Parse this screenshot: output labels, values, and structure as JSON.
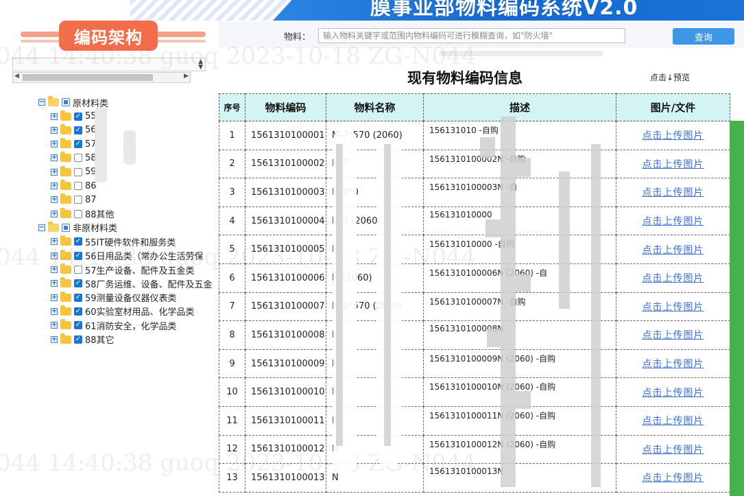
{
  "header": {
    "app_title": "膜事业部物料编码系统V2.0",
    "logo_text": "编码架构"
  },
  "search": {
    "label": "物料：",
    "placeholder": "输入物料关键字或范围内物料编码可进行模糊查询，如\"防火墙\"",
    "button": "查询"
  },
  "table_title": "现有物料编码信息",
  "preview_text": "点击↓预览",
  "tree": {
    "groups": [
      {
        "label": "原材料类",
        "items": [
          {
            "label": "55",
            "checked": true
          },
          {
            "label": "56",
            "checked": true
          },
          {
            "label": "57",
            "checked": true
          },
          {
            "label": "58",
            "checked": false
          },
          {
            "label": "59",
            "checked": false
          },
          {
            "label": "86",
            "checked": false
          },
          {
            "label": "87",
            "checked": false
          },
          {
            "label": "88其他",
            "checked": false
          }
        ]
      },
      {
        "label": "非原材料类",
        "items": [
          {
            "label": "55IT硬件软件和服务类",
            "checked": true
          },
          {
            "label": "56日用品类（常办公生活劳保",
            "checked": true
          },
          {
            "label": "57生产设备、配件及五金类",
            "checked": false
          },
          {
            "label": "58厂务运维、设备、配件及五金",
            "checked": true
          },
          {
            "label": "59测量设备仪器仪表类",
            "checked": true
          },
          {
            "label": "60实验室材用品、化学品类",
            "checked": true
          },
          {
            "label": "61消防安全，化学品类",
            "checked": true
          },
          {
            "label": "88其它",
            "checked": true
          }
        ]
      }
    ]
  },
  "columns": [
    "序号",
    "物料编码",
    "物料名称",
    "描述",
    "图片/文件"
  ],
  "rows": [
    {
      "no": "1",
      "code": "1561310100001",
      "name": "M-7*570 (2060)",
      "desc": "156131010",
      "link": "点击上传图片"
    },
    {
      "no": "2",
      "code": "1561310100002",
      "name": "M-7",
      "desc": "1561310100002N",
      "link": "点击上传图片"
    },
    {
      "no": "3",
      "code": "1561310100003",
      "name": "M-0*0",
      "desc": "1561310100003N",
      "link": "点击上传图片"
    },
    {
      "no": "4",
      "code": "1561310100004",
      "name": "M-7 (2060)",
      "desc": "156131010000",
      "link": "点击上传图片"
    },
    {
      "no": "5",
      "code": "1561310100005",
      "name": "M",
      "desc": "156131010000",
      "link": "点击上传图片"
    },
    {
      "no": "6",
      "code": "1561310100006",
      "name": "M (2060)",
      "desc": "1561310100006N",
      "link": "点击上传图片"
    },
    {
      "no": "7",
      "code": "1561310100007",
      "name": "M-5*570 (2060)",
      "desc": "1561310100007N",
      "link": "点击上传图片"
    },
    {
      "no": "8",
      "code": "1561310100008",
      "name": "M",
      "desc": "1561310100008N",
      "link": "点击上传图片"
    },
    {
      "no": "9",
      "code": "1561310100009",
      "name": "M",
      "desc": "1561310100009N",
      "link": "点击上传图片"
    },
    {
      "no": "10",
      "code": "1561310100010",
      "name": "M",
      "desc": "1561310100010N",
      "link": "点击上传图片"
    },
    {
      "no": "11",
      "code": "1561310100011",
      "name": "M",
      "desc": "1561310100011N",
      "link": "点击上传图片"
    },
    {
      "no": "12",
      "code": "1561310100012",
      "name": "N",
      "desc": "1561310100012N",
      "link": "点击上传图片"
    },
    {
      "no": "13",
      "code": "1561310100013",
      "name": "N",
      "desc": "1561310100013N",
      "link": "点击上传图片"
    }
  ],
  "desc_tails": {
    "1": "-自购",
    "2": "-自购",
    "3": "-自",
    "5": "-自购",
    "6": "(2060) -自",
    "7": "-自购",
    "9": "(2060) -自购",
    "10": "(2060) -自购",
    "11": "(2060) -自购",
    "12": "(2060) -自购"
  },
  "watermark": {
    "line1": "044  14:40:38  guoq  2023-10-18  ZG-N044",
    "line2": "044  14:40:38  guoq  2023-10-18  ZG-N044"
  },
  "colors": {
    "accent": "#1668cf",
    "logo": "#f26e4a",
    "header_row": "#d4f3f3",
    "button": "#3e97e6",
    "link": "#3a6fd0",
    "strip": "#48b04c"
  },
  "icons": {
    "folder": "folder-icon",
    "expand": "plus-square-icon",
    "collapse": "minus-square-icon",
    "checkbox": "checkbox-icon"
  }
}
